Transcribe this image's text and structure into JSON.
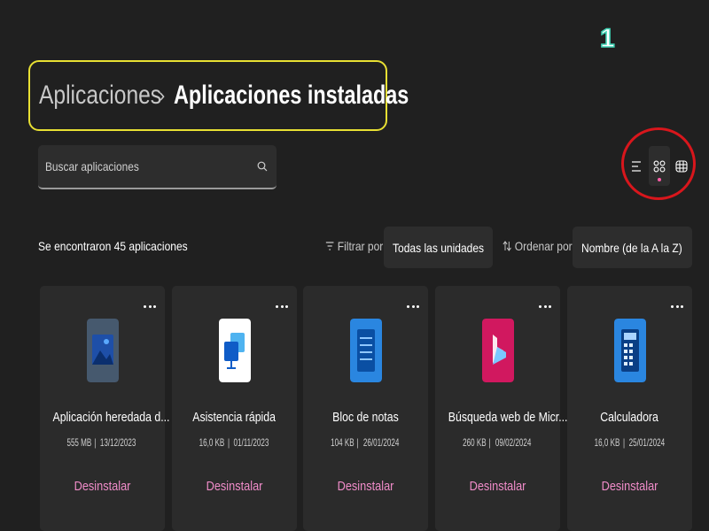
{
  "annotation": {
    "step_number": "1"
  },
  "breadcrumb": {
    "parent": "Aplicaciones",
    "separator": "›",
    "current": "Aplicaciones instaladas"
  },
  "search": {
    "placeholder": "Buscar aplicaciones",
    "icon": "search-icon"
  },
  "view_modes": {
    "selected": "grid",
    "items": [
      {
        "name": "list",
        "icon": "list-view-icon"
      },
      {
        "name": "grid",
        "icon": "grid-view-icon"
      },
      {
        "name": "table",
        "icon": "table-view-icon"
      }
    ]
  },
  "results": {
    "count_text": "Se encontraron 45 aplicaciones"
  },
  "filter": {
    "label": "Filtrar por:",
    "value": "Todas las unidades",
    "icon": "filter-icon"
  },
  "sort": {
    "label": "Ordenar por:",
    "value": "Nombre (de la A la Z)",
    "icon": "sort-icon"
  },
  "colors": {
    "background": "#202020",
    "card": "#2b2b2b",
    "accent_pink": "#f08cc9",
    "highlight_yellow": "#e8e033",
    "highlight_red": "#d8161c"
  },
  "apps": [
    {
      "name": "Aplicación heredada d...",
      "size": "555 MB",
      "date": "13/12/2023",
      "action": "Desinstalar",
      "icon": "legacy-app-icon"
    },
    {
      "name": "Asistencia rápida",
      "size": "16,0 KB",
      "date": "01/11/2023",
      "action": "Desinstalar",
      "icon": "quick-assist-icon"
    },
    {
      "name": "Bloc de notas",
      "size": "104 KB",
      "date": "26/01/2024",
      "action": "Desinstalar",
      "icon": "notepad-icon"
    },
    {
      "name": "Búsqueda web de Micr...",
      "size": "260 KB",
      "date": "09/02/2024",
      "action": "Desinstalar",
      "icon": "bing-icon"
    },
    {
      "name": "Calculadora",
      "size": "16,0 KB",
      "date": "25/01/2024",
      "action": "Desinstalar",
      "icon": "calculator-icon"
    }
  ],
  "meta_separator": " | "
}
